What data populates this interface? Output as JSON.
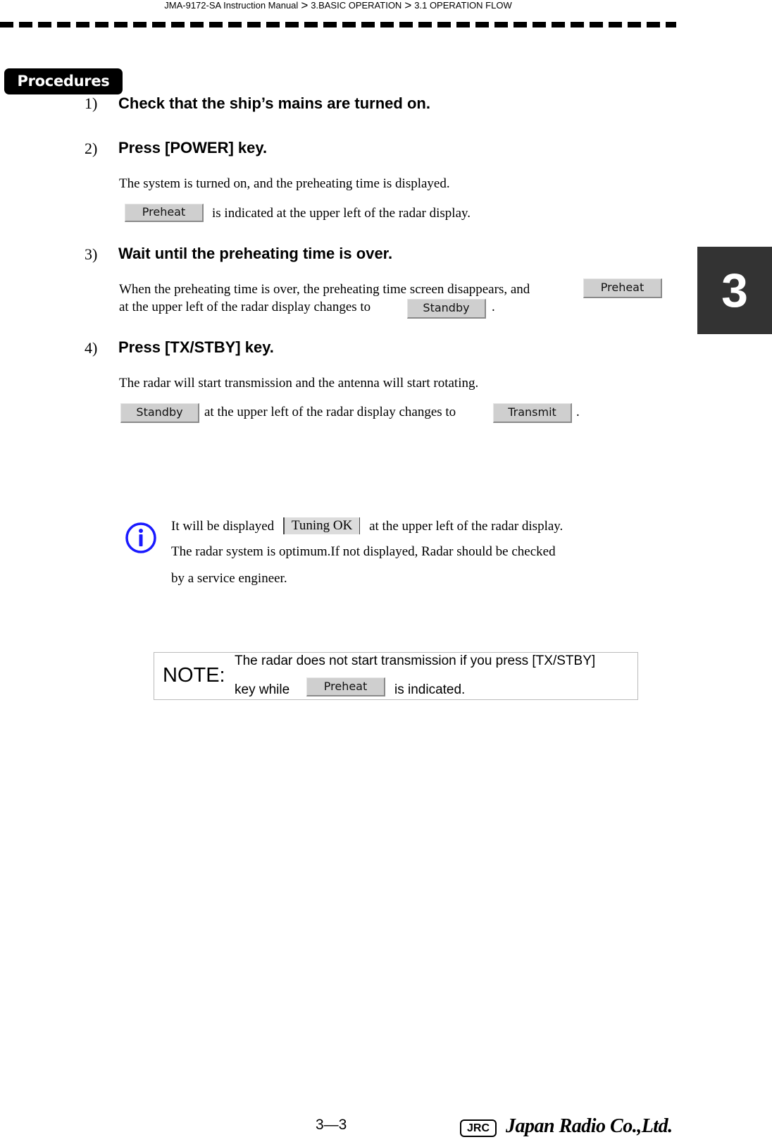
{
  "header": {
    "breadcrumb": [
      "JMA-9172-SA Instruction Manual",
      "3.BASIC OPERATION",
      "3.1  OPERATION FLOW"
    ],
    "separator": ">"
  },
  "section_badge": "Procedures",
  "chapter_tab": "3",
  "steps": [
    {
      "number": "1)",
      "title": "Check that the ship’s mains are turned on."
    },
    {
      "number": "2)",
      "title": "Press [POWER] key.",
      "text1": "The system is turned on, and the preheating time is displayed.",
      "indicator": "Preheat",
      "text2": "is indicated at the upper left of the radar display."
    },
    {
      "number": "3)",
      "title": "Wait until the preheating time is over.",
      "text1": "When the preheating time is over, the preheating time screen disappears, and",
      "indicator1": "Preheat",
      "text2": "at the upper left of the radar display changes to",
      "indicator2": "Standby",
      "text3": "."
    },
    {
      "number": "4)",
      "title": "Press [TX/STBY] key.",
      "text1": "The radar will start transmission and the antenna will start rotating.",
      "indicator1": "Standby",
      "text2": "at the upper left of the radar display changes to",
      "indicator2": "Transmit",
      "text3": "."
    }
  ],
  "info": {
    "icon": "info-icon",
    "line1_a": "It will be displayed",
    "indicator": "Tuning OK",
    "line1_b": "at the upper left of the radar display.",
    "line2": "The radar system is optimum.If not displayed, Radar should be checked",
    "line3": "by a service engineer."
  },
  "note": {
    "label": "NOTE:",
    "line1": "The radar does not start transmission if you press [TX/STBY]",
    "line2_a": "key while",
    "indicator": "Preheat",
    "line2_b": "is indicated."
  },
  "footer": {
    "page_number": "3—3",
    "logo_abbr": "JRC",
    "company": "Japan Radio Co.,Ltd."
  }
}
